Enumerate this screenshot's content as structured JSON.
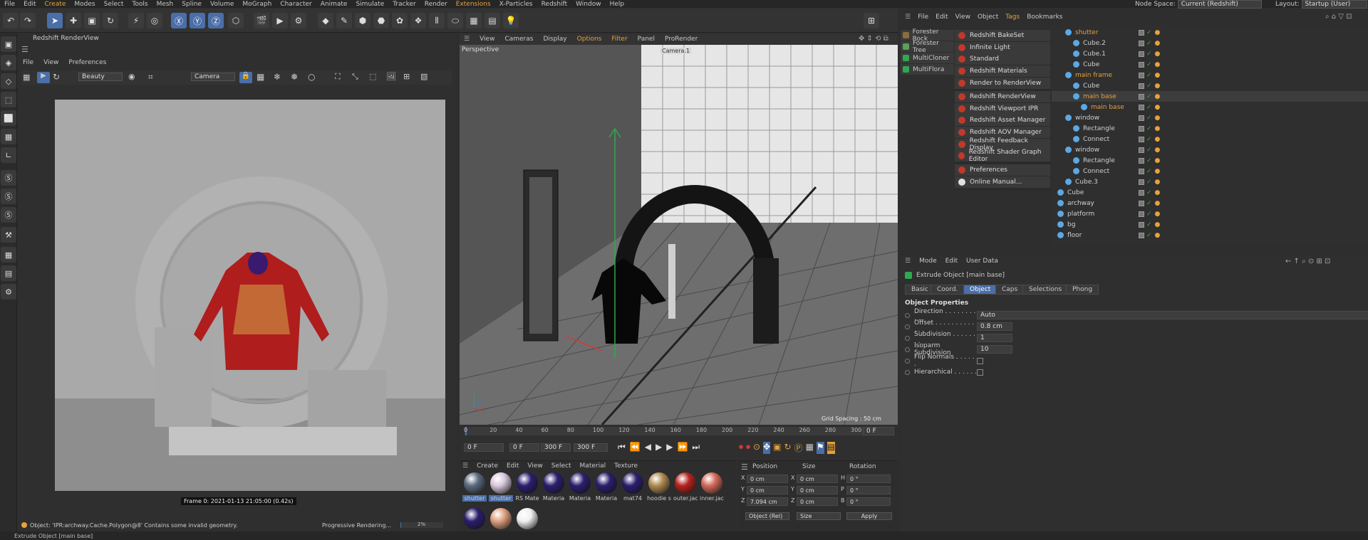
{
  "menubar": {
    "items": [
      "File",
      "Edit",
      "Create",
      "Modes",
      "Select",
      "Tools",
      "Mesh",
      "Spline",
      "Volume",
      "MoGraph",
      "Character",
      "Animate",
      "Simulate",
      "Tracker",
      "Render",
      "Extensions",
      "X-Particles",
      "Redshift",
      "Window",
      "Help"
    ],
    "node_space_label": "Node Space:",
    "node_space_value": "Current (Redshift)",
    "layout_label": "Layout:",
    "layout_value": "Startup (User)"
  },
  "renderview": {
    "title": "Redshift RenderView",
    "menu": [
      "File",
      "View",
      "Preferences"
    ],
    "aov": "Beauty",
    "camera": "Camera",
    "frame_info": "Frame 0:  2021-01-13  21:05:00  (0.42s)"
  },
  "viewport": {
    "menu": [
      "View",
      "Cameras",
      "Display",
      "Options",
      "Filter",
      "Panel",
      "ProRender"
    ],
    "view_name": "Perspective",
    "camera_tag": "Camera.1",
    "grid_spacing": "Grid Spacing : 50 cm"
  },
  "timeline": {
    "ticks": [
      "0",
      "20",
      "40",
      "60",
      "80",
      "100",
      "120",
      "140",
      "160",
      "180",
      "200",
      "220",
      "240",
      "260",
      "280",
      "300"
    ],
    "current_frame": "0 F",
    "start": "0 F",
    "min": "0 F",
    "max": "300 F",
    "end": "300 F",
    "frame_readout": "0 F"
  },
  "materials": {
    "menu": [
      "Create",
      "Edit",
      "View",
      "Select",
      "Material",
      "Texture"
    ],
    "items": [
      {
        "label": "shutter",
        "color": "#5b6b80"
      },
      {
        "label": "shutter",
        "color": "#d8c8dc"
      },
      {
        "label": "RS Mate",
        "color": "#2b1e6e"
      },
      {
        "label": "Materia",
        "color": "#2b1e6e"
      },
      {
        "label": "Materia",
        "color": "#2b1e6e"
      },
      {
        "label": "Materia",
        "color": "#2b1e6e"
      },
      {
        "label": "mat74",
        "color": "#2b1e6e"
      },
      {
        "label": "hoodie s",
        "color": "#b08a50"
      },
      {
        "label": "outer.jac",
        "color": "#b8231e"
      },
      {
        "label": "inner.jac",
        "color": "#d46a5a"
      },
      {
        "label": "",
        "color": "#2b1e6e"
      },
      {
        "label": "",
        "color": "#e0a080"
      },
      {
        "label": "",
        "color": "#f0f0f0"
      }
    ]
  },
  "coords": {
    "headers": [
      "Position",
      "Size",
      "Rotation"
    ],
    "rows": [
      {
        "axis": "X",
        "pos": "0 cm",
        "size_axis": "X",
        "size": "0 cm",
        "rot_axis": "H",
        "rot": "0 °"
      },
      {
        "axis": "Y",
        "pos": "0 cm",
        "size_axis": "Y",
        "size": "0 cm",
        "rot_axis": "P",
        "rot": "0 °"
      },
      {
        "axis": "Z",
        "pos": "7.094 cm",
        "size_axis": "Z",
        "size": "0 cm",
        "rot_axis": "B",
        "rot": "0 °"
      }
    ],
    "mode": "Object (Rel)",
    "size_mode": "Size",
    "apply": "Apply"
  },
  "plugins": [
    "Forester Rock",
    "Forester Tree",
    "MultiCloner",
    "MultiFlora"
  ],
  "redshift_menu": [
    "Redshift BakeSet",
    "Infinite Light",
    "Standard",
    "Redshift Materials",
    "Render to RenderView",
    "Redshift RenderView",
    "Redshift Viewport IPR",
    "Redshift Asset Manager",
    "Redshift AOV Manager",
    "Redshift Feedback Display",
    "Redshift Shader Graph Editor",
    "Preferences",
    "Online Manual..."
  ],
  "object_manager": {
    "menu": [
      "File",
      "Edit",
      "View",
      "Object",
      "Tags",
      "Bookmarks"
    ],
    "objects": [
      {
        "name": "shutter",
        "indent": 1,
        "color": "#e6a23c"
      },
      {
        "name": "Cube.2",
        "indent": 2,
        "color": "#d0d0d0"
      },
      {
        "name": "Cube.1",
        "indent": 2,
        "color": "#d0d0d0"
      },
      {
        "name": "Cube",
        "indent": 2,
        "color": "#d0d0d0"
      },
      {
        "name": "main frame",
        "indent": 1,
        "color": "#e6a23c"
      },
      {
        "name": "Cube",
        "indent": 2,
        "color": "#d0d0d0"
      },
      {
        "name": "main base",
        "indent": 2,
        "color": "#e6a23c"
      },
      {
        "name": "main base",
        "indent": 3,
        "color": "#e6a23c"
      },
      {
        "name": "window",
        "indent": 1,
        "color": "#d0d0d0"
      },
      {
        "name": "Rectangle",
        "indent": 2,
        "color": "#d0d0d0"
      },
      {
        "name": "Connect",
        "indent": 2,
        "color": "#d0d0d0"
      },
      {
        "name": "window",
        "indent": 1,
        "color": "#d0d0d0"
      },
      {
        "name": "Rectangle",
        "indent": 2,
        "color": "#d0d0d0"
      },
      {
        "name": "Connect",
        "indent": 2,
        "color": "#d0d0d0"
      },
      {
        "name": "Cube.3",
        "indent": 1,
        "color": "#d0d0d0"
      },
      {
        "name": "Cube",
        "indent": 0,
        "color": "#d0d0d0"
      },
      {
        "name": "archway",
        "indent": 0,
        "color": "#d0d0d0"
      },
      {
        "name": "platform",
        "indent": 0,
        "color": "#d0d0d0"
      },
      {
        "name": "bg",
        "indent": 0,
        "color": "#d0d0d0"
      },
      {
        "name": "floor",
        "indent": 0,
        "color": "#d0d0d0"
      }
    ]
  },
  "attributes": {
    "menu": [
      "Mode",
      "Edit",
      "User Data"
    ],
    "object_title": "Extrude Object [main base]",
    "tabs": [
      "Basic",
      "Coord.",
      "Object",
      "Caps",
      "Selections",
      "Phong"
    ],
    "active_tab": "Object",
    "section": "Object Properties",
    "props": [
      {
        "label": "Direction . . . . . . . . . .",
        "value": "Auto"
      },
      {
        "label": "Offset . . . . . . . . . . . .",
        "value": "0.8 cm"
      },
      {
        "label": "Subdivision . . . . . . . .",
        "value": "1"
      },
      {
        "label": "Isoparm Subdivision",
        "value": "10"
      },
      {
        "label": "Flip Normals . . . . . .",
        "value": ""
      },
      {
        "label": "Hierarchical . . . . . .",
        "value": ""
      }
    ]
  },
  "status": {
    "message": "Object: 'IPR:archway.Cache.Polygon@8' Contains some invalid geometry.",
    "progress_text": "Progressive Rendering...",
    "progress_pct": "2%",
    "bottom": "Extrude Object [main base]"
  },
  "colors": {
    "accent": "#e6a23c",
    "selection": "#4a6ea8",
    "redshift": "#c0392b"
  }
}
